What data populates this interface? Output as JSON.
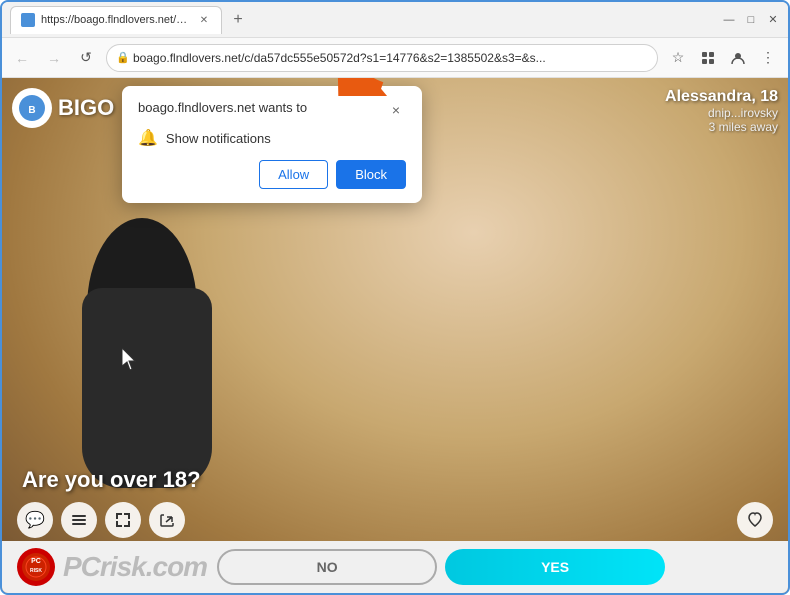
{
  "browser": {
    "url": "boago.flndlovers.net/c/da57dc555e50572d?s1=14776&s2=1385502&s3=&s...",
    "tab_title": "https://boago.flndlovers.net/c/d...",
    "new_tab_label": "+"
  },
  "nav": {
    "back": "←",
    "forward": "→",
    "refresh": "↺"
  },
  "toolbar": {
    "bookmark": "☆",
    "extensions": "🧩",
    "profile": "👤",
    "menu": "⋮"
  },
  "page": {
    "logo_text": "BIGO",
    "user_name": "Alessandra, 18",
    "user_location": "dnip...irovsky",
    "user_distance": "3 miles away",
    "age_question": "Are you over 18?",
    "no_label": "NO",
    "yes_label": "YES",
    "watermark": "PCrisk.com"
  },
  "dialog": {
    "site_text": "boago.flndlovers.net wants to",
    "permission_label": "Show notifications",
    "allow_label": "Allow",
    "block_label": "Block",
    "close_label": "×"
  },
  "icons": {
    "lock": "🔒",
    "bell": "🔔",
    "chat": "💬",
    "list": "≡",
    "fullscreen": "⛶",
    "share": "↪",
    "heart": "♡",
    "minimize": "—",
    "maximize": "□",
    "close": "✕"
  },
  "colors": {
    "accent_blue": "#1a73e8",
    "chrome_bg": "#f2f2f2",
    "yes_gradient_start": "#00c8e0",
    "yes_gradient_end": "#00e4f8"
  }
}
